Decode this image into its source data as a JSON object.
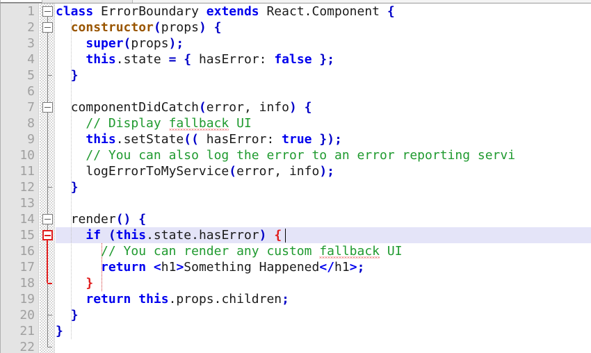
{
  "app": {
    "type": "code-editor",
    "language": "JavaScript / JSX",
    "font_size_px": 18,
    "line_height_px": 23
  },
  "colors": {
    "background": "#ffffff",
    "gutter_background": "#e4e4e4",
    "gutter_text": "#a0a0a0",
    "keyword": "#0000ee",
    "constructor": "#995500",
    "comment": "#1f9a2f",
    "text": "#1b1b1b",
    "punctuation": "#0000c8",
    "error_brace": "#e01b1b",
    "current_line_highlight": "#e4e4f8",
    "spellcheck_underline": "#e02020",
    "fold_marker": "#7a7a7a",
    "fold_marker_active": "#e01b1b"
  },
  "gutter": {
    "line_numbers": [
      "1",
      "2",
      "3",
      "4",
      "5",
      "6",
      "7",
      "8",
      "9",
      "10",
      "11",
      "12",
      "13",
      "14",
      "15",
      "16",
      "17",
      "18",
      "19",
      "20",
      "21",
      "22"
    ],
    "fold_markers": [
      {
        "line": 1,
        "state": "expanded",
        "active": false
      },
      {
        "line": 2,
        "state": "expanded",
        "active": false
      },
      {
        "line": 7,
        "state": "expanded",
        "active": false
      },
      {
        "line": 14,
        "state": "expanded",
        "active": false
      },
      {
        "line": 15,
        "state": "expanded",
        "active": true
      }
    ]
  },
  "editor": {
    "current_line": 15,
    "caret_line": 15,
    "caret_after_text": "    if (this.state.hasError) {",
    "spellcheck_words": [
      "fallback"
    ],
    "matching_braces": {
      "open_line": 15,
      "close_line": 18
    },
    "lines": [
      {
        "n": 1,
        "indent": 0,
        "tokens": [
          {
            "t": "class",
            "c": "kw"
          },
          {
            "t": " ",
            "c": "plain"
          },
          {
            "t": "ErrorBoundary",
            "c": "plain"
          },
          {
            "t": " ",
            "c": "plain"
          },
          {
            "t": "extends",
            "c": "kw"
          },
          {
            "t": " ",
            "c": "plain"
          },
          {
            "t": "React.Component",
            "c": "plain"
          },
          {
            "t": " ",
            "c": "plain"
          },
          {
            "t": "{",
            "c": "punc"
          }
        ]
      },
      {
        "n": 2,
        "indent": 1,
        "tokens": [
          {
            "t": "constructor",
            "c": "ctor"
          },
          {
            "t": "(",
            "c": "punc"
          },
          {
            "t": "props",
            "c": "plain"
          },
          {
            "t": ")",
            "c": "punc"
          },
          {
            "t": " ",
            "c": "plain"
          },
          {
            "t": "{",
            "c": "punc"
          }
        ]
      },
      {
        "n": 3,
        "indent": 2,
        "tokens": [
          {
            "t": "super",
            "c": "kw"
          },
          {
            "t": "(",
            "c": "punc"
          },
          {
            "t": "props",
            "c": "plain"
          },
          {
            "t": ")",
            "c": "punc"
          },
          {
            "t": ";",
            "c": "punc"
          }
        ]
      },
      {
        "n": 4,
        "indent": 2,
        "tokens": [
          {
            "t": "this",
            "c": "kw"
          },
          {
            "t": ".",
            "c": "plain"
          },
          {
            "t": "state",
            "c": "plain"
          },
          {
            "t": " ",
            "c": "plain"
          },
          {
            "t": "=",
            "c": "punc"
          },
          {
            "t": " ",
            "c": "plain"
          },
          {
            "t": "{",
            "c": "punc"
          },
          {
            "t": " hasError: ",
            "c": "plain"
          },
          {
            "t": "false",
            "c": "kw"
          },
          {
            "t": " ",
            "c": "plain"
          },
          {
            "t": "}",
            "c": "punc"
          },
          {
            "t": ";",
            "c": "punc"
          }
        ]
      },
      {
        "n": 5,
        "indent": 1,
        "tokens": [
          {
            "t": "}",
            "c": "punc"
          }
        ]
      },
      {
        "n": 6,
        "indent": 0,
        "tokens": []
      },
      {
        "n": 7,
        "indent": 1,
        "tokens": [
          {
            "t": "componentDidCatch",
            "c": "plain"
          },
          {
            "t": "(",
            "c": "punc"
          },
          {
            "t": "error, info",
            "c": "plain"
          },
          {
            "t": ")",
            "c": "punc"
          },
          {
            "t": " ",
            "c": "plain"
          },
          {
            "t": "{",
            "c": "punc"
          }
        ]
      },
      {
        "n": 8,
        "indent": 2,
        "tokens": [
          {
            "t": "// Display ",
            "c": "cmt"
          },
          {
            "t": "fallback",
            "c": "cmt",
            "spell": true
          },
          {
            "t": " UI",
            "c": "cmt"
          }
        ]
      },
      {
        "n": 9,
        "indent": 2,
        "tokens": [
          {
            "t": "this",
            "c": "kw"
          },
          {
            "t": ".",
            "c": "plain"
          },
          {
            "t": "setState",
            "c": "plain"
          },
          {
            "t": "((",
            "c": "punc"
          },
          {
            "t": " hasError: ",
            "c": "plain"
          },
          {
            "t": "true",
            "c": "kw"
          },
          {
            "t": " ",
            "c": "plain"
          },
          {
            "t": "}",
            "c": "punc"
          },
          {
            "t": ")",
            "c": "punc"
          },
          {
            "t": ";",
            "c": "punc"
          }
        ]
      },
      {
        "n": 10,
        "indent": 2,
        "tokens": [
          {
            "t": "// You can also log the error to an error reporting servi",
            "c": "cmt"
          }
        ]
      },
      {
        "n": 11,
        "indent": 2,
        "tokens": [
          {
            "t": "logErrorToMyService",
            "c": "plain"
          },
          {
            "t": "(",
            "c": "punc"
          },
          {
            "t": "error, info",
            "c": "plain"
          },
          {
            "t": ")",
            "c": "punc"
          },
          {
            "t": ";",
            "c": "punc"
          }
        ]
      },
      {
        "n": 12,
        "indent": 1,
        "tokens": [
          {
            "t": "}",
            "c": "punc"
          }
        ]
      },
      {
        "n": 13,
        "indent": 0,
        "tokens": []
      },
      {
        "n": 14,
        "indent": 1,
        "tokens": [
          {
            "t": "render",
            "c": "plain"
          },
          {
            "t": "()",
            "c": "punc"
          },
          {
            "t": " ",
            "c": "plain"
          },
          {
            "t": "{",
            "c": "punc"
          }
        ]
      },
      {
        "n": 15,
        "indent": 2,
        "tokens": [
          {
            "t": "if",
            "c": "kw"
          },
          {
            "t": " ",
            "c": "plain"
          },
          {
            "t": "(",
            "c": "punc"
          },
          {
            "t": "this",
            "c": "kw"
          },
          {
            "t": ".state.hasError",
            "c": "plain"
          },
          {
            "t": ")",
            "c": "punc"
          },
          {
            "t": " ",
            "c": "plain"
          },
          {
            "t": "{",
            "c": "brace-err"
          }
        ]
      },
      {
        "n": 16,
        "indent": 3,
        "tokens": [
          {
            "t": "// You can render any custom ",
            "c": "cmt"
          },
          {
            "t": "fallback",
            "c": "cmt",
            "spell": true
          },
          {
            "t": " UI",
            "c": "cmt"
          }
        ]
      },
      {
        "n": 17,
        "indent": 3,
        "tokens": [
          {
            "t": "return",
            "c": "kw"
          },
          {
            "t": " ",
            "c": "plain"
          },
          {
            "t": "<",
            "c": "tag"
          },
          {
            "t": "h1",
            "c": "plain"
          },
          {
            "t": ">",
            "c": "tag"
          },
          {
            "t": "Something Happened",
            "c": "plain"
          },
          {
            "t": "</",
            "c": "tag"
          },
          {
            "t": "h1",
            "c": "plain"
          },
          {
            "t": ">",
            "c": "tag"
          },
          {
            "t": ";",
            "c": "punc"
          }
        ]
      },
      {
        "n": 18,
        "indent": 2,
        "tokens": [
          {
            "t": "}",
            "c": "brace-err"
          }
        ]
      },
      {
        "n": 19,
        "indent": 2,
        "tokens": [
          {
            "t": "return",
            "c": "kw"
          },
          {
            "t": " ",
            "c": "plain"
          },
          {
            "t": "this",
            "c": "kw"
          },
          {
            "t": ".props.children",
            "c": "plain"
          },
          {
            "t": ";",
            "c": "punc"
          }
        ]
      },
      {
        "n": 20,
        "indent": 1,
        "tokens": [
          {
            "t": "}",
            "c": "punc"
          }
        ]
      },
      {
        "n": 21,
        "indent": 0,
        "tokens": [
          {
            "t": "}",
            "c": "punc"
          }
        ]
      },
      {
        "n": 22,
        "indent": 0,
        "tokens": []
      }
    ]
  }
}
